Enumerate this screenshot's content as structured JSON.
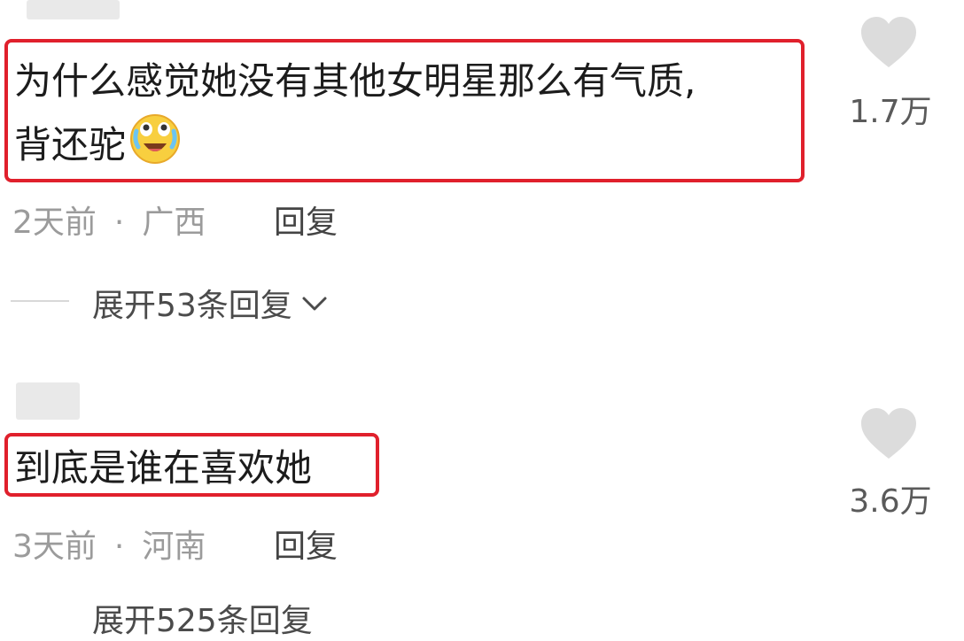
{
  "comments": [
    {
      "text_line1": "为什么感觉她没有其他女明星那么有气质,",
      "text_line2": "背还驼",
      "emoji": "laughing-crying-emoji",
      "time": "2天前",
      "location": "广西",
      "reply_label": "回复",
      "expand_label": "展开53条回复",
      "likes": "1.7万"
    },
    {
      "text_line1": "到底是谁在喜欢她",
      "time": "3天前",
      "location": "河南",
      "reply_label": "回复",
      "expand_label": "展开525条回复",
      "likes": "3.6万"
    }
  ],
  "separator": "·",
  "colors": {
    "highlight_border": "#e0202c",
    "heart": "#dcdcdc"
  },
  "icons": [
    "heart-icon",
    "chevron-down-icon"
  ]
}
